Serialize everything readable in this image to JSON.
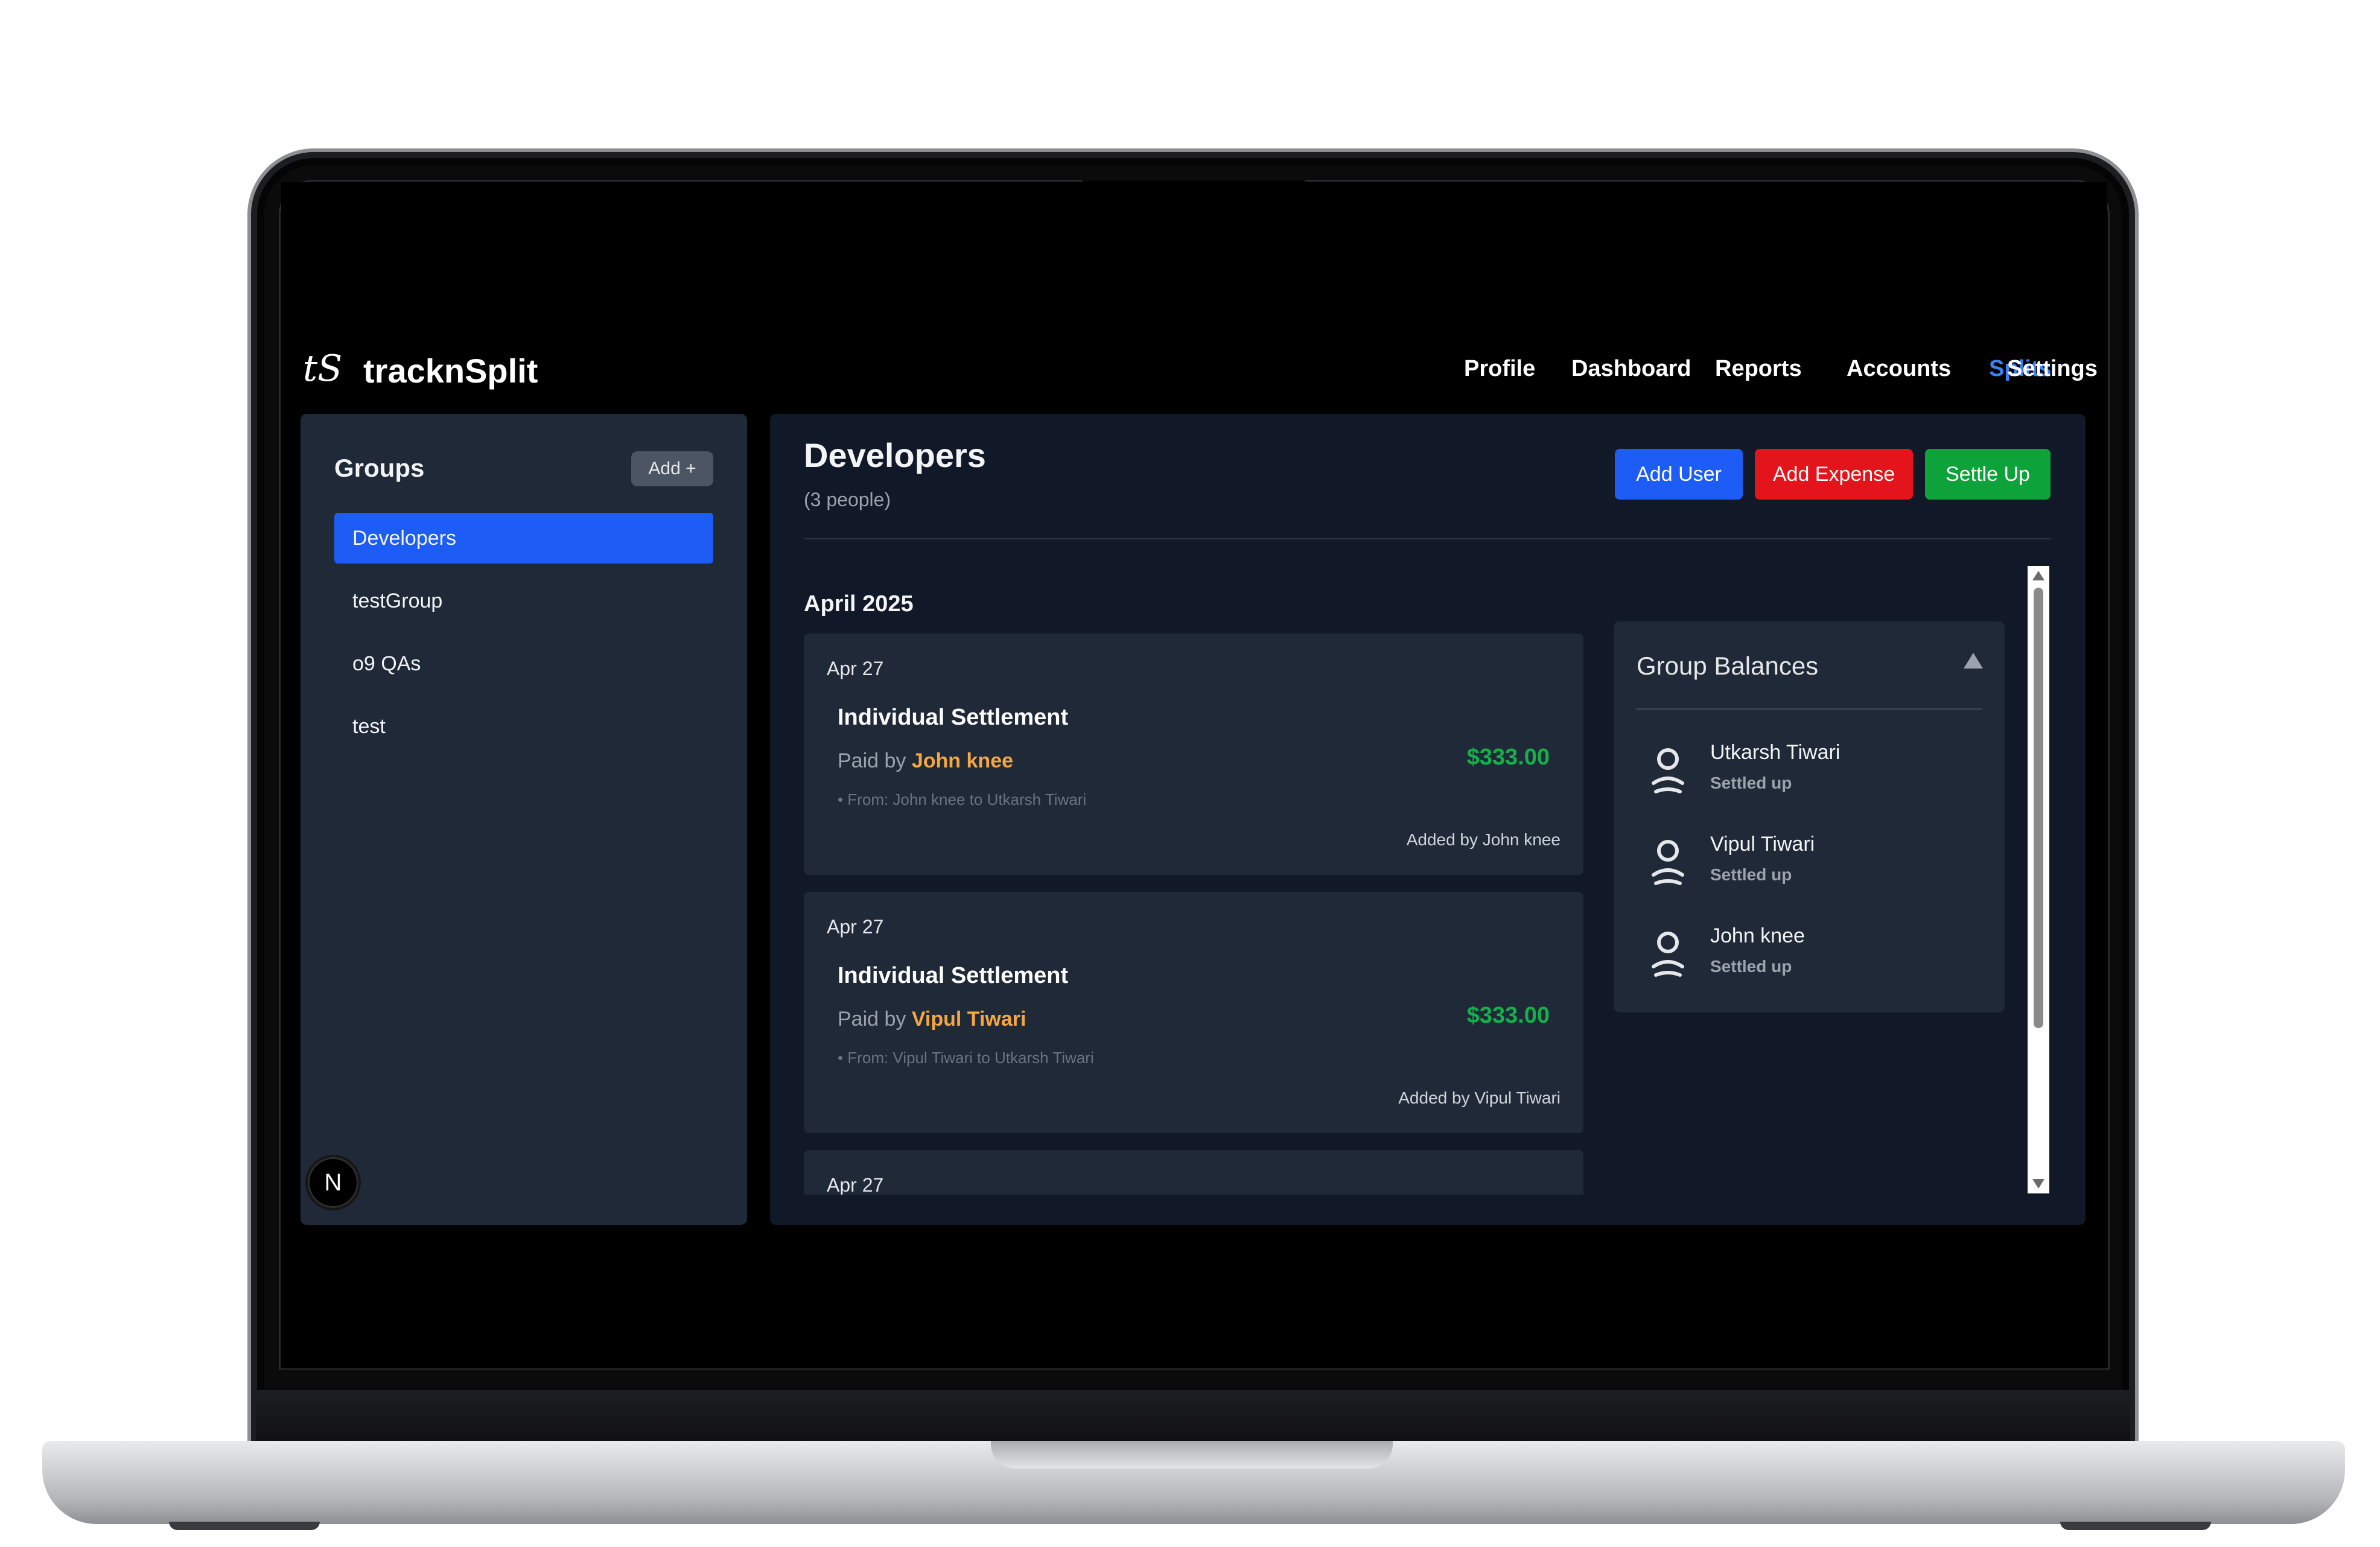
{
  "app": {
    "logo_mark": "tS",
    "name": "tracknSplit"
  },
  "nav": {
    "items": [
      {
        "label": "Profile",
        "active": false
      },
      {
        "label": "Dashboard",
        "active": false
      },
      {
        "label": "Reports",
        "active": false
      },
      {
        "label": "Accounts",
        "active": false
      },
      {
        "label": "Splits",
        "active": true
      },
      {
        "label": "Settings",
        "active": false
      }
    ]
  },
  "sidebar": {
    "title": "Groups",
    "add_label": "Add +",
    "groups": [
      {
        "label": "Developers",
        "selected": true
      },
      {
        "label": "testGroup",
        "selected": false
      },
      {
        "label": "o9 QAs",
        "selected": false
      },
      {
        "label": "test",
        "selected": false
      }
    ],
    "badge": "N"
  },
  "group": {
    "name": "Developers",
    "count_text": "(3 people)",
    "actions": {
      "add_user": "Add User",
      "add_expense": "Add Expense",
      "settle_up": "Settle Up"
    }
  },
  "feed": {
    "month": "April 2025",
    "cards": [
      {
        "date": "Apr 27",
        "title": "Individual Settlement",
        "paid_prefix": "Paid by ",
        "payer": "John knee",
        "from_text": "• From: John knee to Utkarsh Tiwari",
        "amount": "$333.00",
        "added_by": "Added by John knee"
      },
      {
        "date": "Apr 27",
        "title": "Individual Settlement",
        "paid_prefix": "Paid by ",
        "payer": "Vipul Tiwari",
        "from_text": "• From: Vipul Tiwari to Utkarsh Tiwari",
        "amount": "$333.00",
        "added_by": "Added by Vipul Tiwari"
      },
      {
        "date": "Apr 27"
      }
    ]
  },
  "balances": {
    "title": "Group Balances",
    "members": [
      {
        "name": "Utkarsh Tiwari",
        "status": "Settled up"
      },
      {
        "name": "Vipul Tiwari",
        "status": "Settled up"
      },
      {
        "name": "John knee",
        "status": "Settled up"
      }
    ]
  },
  "colors": {
    "accent": "#1d5df5",
    "danger": "#e3141b",
    "success": "#0ea33a",
    "payer": "#f5a742",
    "amount": "#14b04a"
  },
  "icons": [
    "user-icon",
    "triangle-up-icon"
  ]
}
